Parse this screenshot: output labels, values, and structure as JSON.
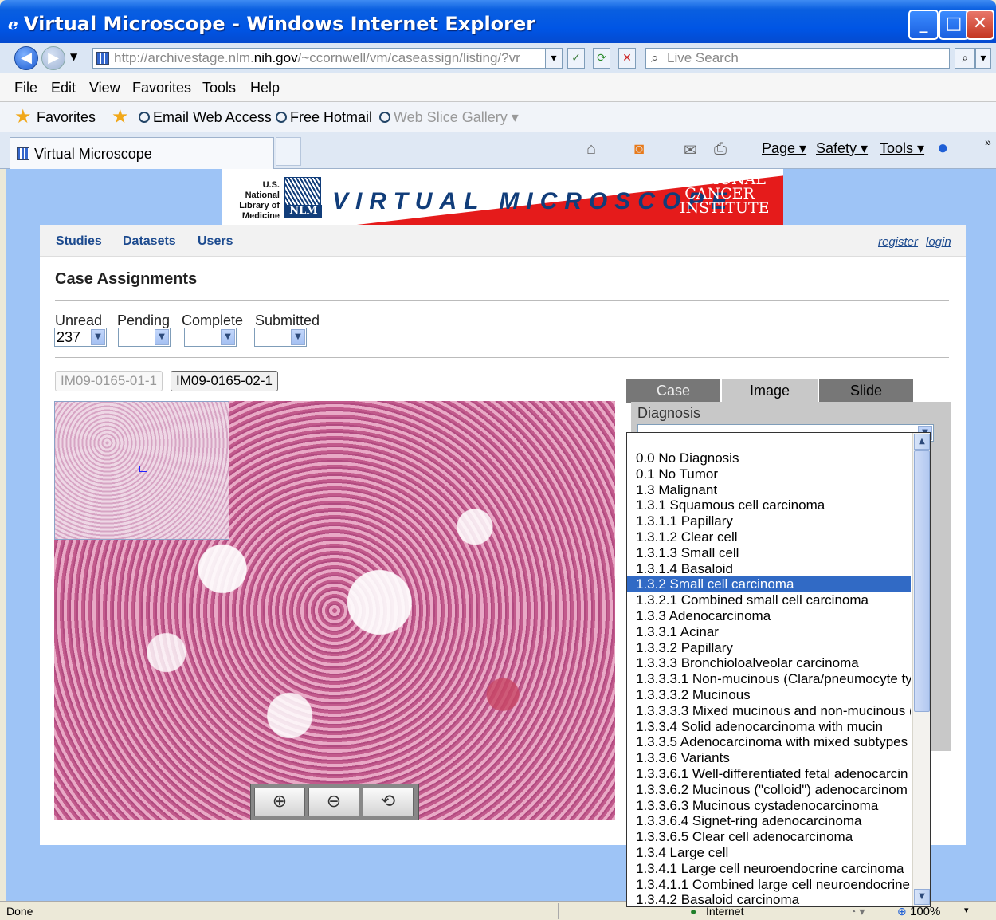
{
  "window": {
    "title": "Virtual Microscope - Windows Internet Explorer"
  },
  "address": {
    "url_gray1": "http://archivestage.nlm.",
    "url_dark": "nih.gov",
    "url_gray2": "/~ccornwell/vm/caseassign/listing/?vr"
  },
  "search": {
    "placeholder": "Live Search"
  },
  "menu": {
    "file": "File",
    "edit": "Edit",
    "view": "View",
    "favorites": "Favorites",
    "tools": "Tools",
    "help": "Help"
  },
  "favbar": {
    "favorites": "Favorites",
    "email": "Email Web Access",
    "hotmail": "Free Hotmail",
    "webslice": "Web Slice Gallery ▾"
  },
  "tab": {
    "title": "Virtual Microscope"
  },
  "commandbar": {
    "page": "Page ▾",
    "safety": "Safety ▾",
    "tools": "Tools ▾"
  },
  "banner": {
    "nlm_text": "U.S. National Library of Medicine",
    "nlm_logo": "NLM",
    "title": "VIRTUAL MICROSCOPE",
    "nci": "NATIONAL CANCER INSTITUTE"
  },
  "nav": {
    "studies": "Studies",
    "datasets": "Datasets",
    "users": "Users",
    "register": "register",
    "login": "login"
  },
  "page": {
    "title": "Case Assignments"
  },
  "filters": {
    "unread_label": "Unread",
    "unread_value": "237",
    "pending_label": "Pending",
    "pending_value": "",
    "complete_label": "Complete",
    "complete_value": "",
    "submitted_label": "Submitted",
    "submitted_value": ""
  },
  "cases": {
    "case1": "IM09-0165-01-1",
    "case2": "IM09-0165-02-1"
  },
  "panel_tabs": {
    "case": "Case",
    "image": "Image",
    "slide": "Slide"
  },
  "panel": {
    "diagnosis_label": "Diagnosis",
    "diagnosis_value": ""
  },
  "diagnosis_options": [
    "0.0 No Diagnosis",
    "0.1 No Tumor",
    "1.3 Malignant",
    "1.3.1 Squamous cell carcinoma",
    "1.3.1.1 Papillary",
    "1.3.1.2 Clear cell",
    "1.3.1.3 Small cell",
    "1.3.1.4 Basaloid",
    "1.3.2 Small cell carcinoma",
    "1.3.2.1 Combined small cell carcinoma",
    "1.3.3 Adenocarcinoma",
    "1.3.3.1 Acinar",
    "1.3.3.2 Papillary",
    "1.3.3.3 Bronchioloalveolar carcinoma",
    "1.3.3.3.1 Non-mucinous (Clara/pneumocyte ty",
    "1.3.3.3.2 Mucinous",
    "1.3.3.3.3 Mixed mucinous and non-mucinous (",
    "1.3.3.4 Solid adenocarcinoma with mucin",
    "1.3.3.5 Adenocarcinoma with mixed subtypes",
    "1.3.3.6 Variants",
    "1.3.3.6.1 Well-differentiated fetal adenocarcin",
    "1.3.3.6.2 Mucinous (\"colloid\") adenocarcinom",
    "1.3.3.6.3 Mucinous cystadenocarcinoma",
    "1.3.3.6.4 Signet-ring adenocarcinoma",
    "1.3.3.6.5 Clear cell adenocarcinoma",
    "1.3.4 Large cell",
    "1.3.4.1 Large cell neuroendocrine carcinoma",
    "1.3.4.1.1 Combined large cell neuroendocrine",
    "1.3.4.2 Basaloid carcinoma"
  ],
  "selected_option": "1.3.2 Small cell carcinoma",
  "status": {
    "left": "Done",
    "zone": "Internet",
    "zoom": "100%"
  }
}
